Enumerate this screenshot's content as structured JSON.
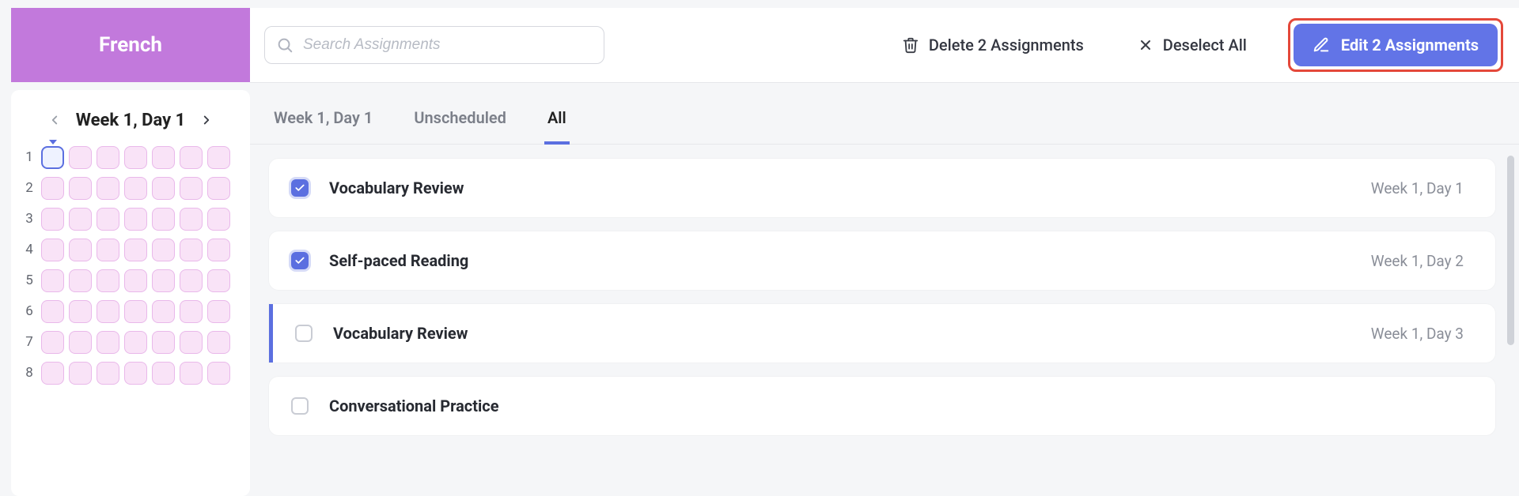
{
  "subject": {
    "name": "French"
  },
  "weekNav": {
    "title": "Week 1, Day 1"
  },
  "grid": {
    "rows": 8,
    "cols": 7,
    "selected": {
      "row": 1,
      "col": 1
    }
  },
  "search": {
    "placeholder": "Search Assignments"
  },
  "actions": {
    "delete_label": "Delete 2 Assignments",
    "deselect_label": "Deselect All",
    "edit_label": "Edit 2 Assignments"
  },
  "tabs": {
    "items": [
      "Week 1, Day 1",
      "Unscheduled",
      "All"
    ],
    "active_index": 2
  },
  "assignments": [
    {
      "title": "Vocabulary Review",
      "date": "Week 1, Day 1",
      "checked": true,
      "accent": false
    },
    {
      "title": "Self-paced Reading",
      "date": "Week 1, Day 2",
      "checked": true,
      "accent": false
    },
    {
      "title": "Vocabulary Review",
      "date": "Week 1, Day 3",
      "checked": false,
      "accent": true
    },
    {
      "title": "Conversational Practice",
      "date": "",
      "checked": false,
      "accent": false
    }
  ]
}
